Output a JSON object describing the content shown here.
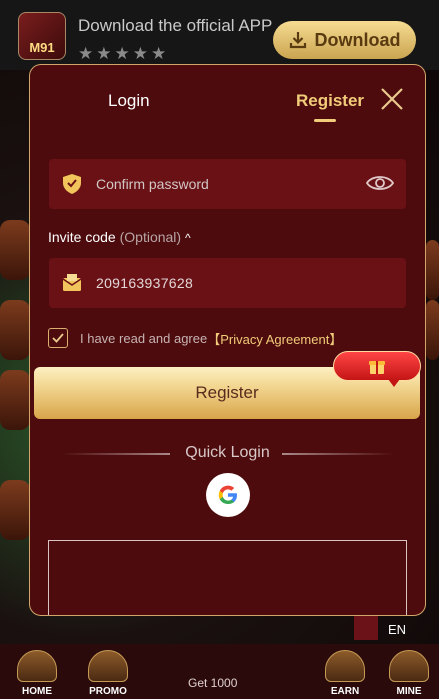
{
  "banner": {
    "logo_text": "M91",
    "promo_text": "Download the official APP t...",
    "stars": "★★★★★",
    "download_label": "Download"
  },
  "modal": {
    "tabs": {
      "login": "Login",
      "register": "Register"
    },
    "confirm_password_placeholder": "Confirm password",
    "invite_label": "Invite code",
    "invite_optional": "(Optional)",
    "invite_value": "209163937628",
    "agree_text": "I have read and agree",
    "privacy_link": "【Privacy Agreement】",
    "register_button": "Register",
    "quick_login": "Quick Login"
  },
  "language": {
    "code": "EN"
  },
  "bottom_nav": {
    "items": [
      "HOME",
      "PROMO",
      "EARN",
      "MINE"
    ],
    "center_label": "Get 1000"
  },
  "colors": {
    "modal_bg": "#4d0b0d",
    "accent_gold": "#f1cc7a",
    "field_bg": "#6a1115"
  }
}
